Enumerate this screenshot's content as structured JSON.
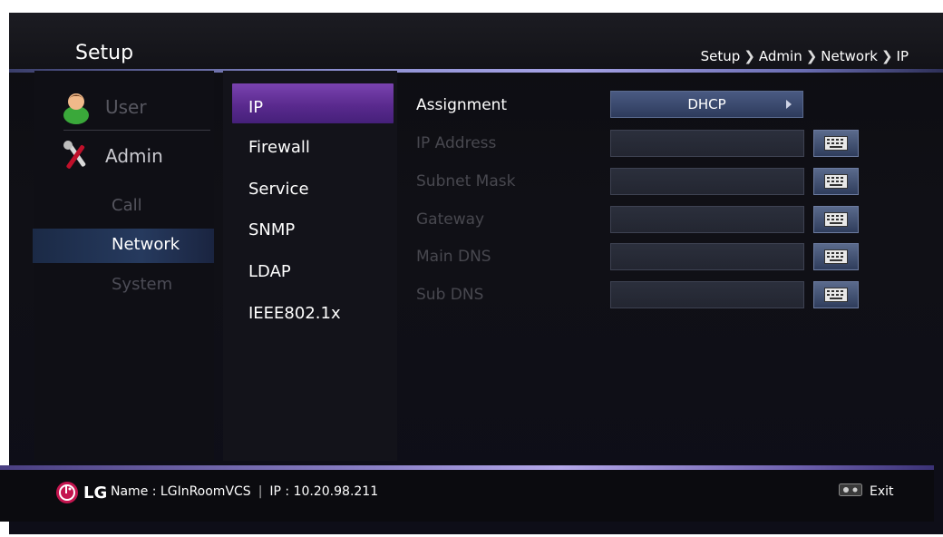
{
  "header": {
    "title": "Setup",
    "breadcrumb": [
      "Setup",
      "Admin",
      "Network",
      "IP"
    ],
    "breadcrumb_sep": "❯"
  },
  "left_menu": {
    "user_label": "User",
    "admin_label": "Admin",
    "sub_items": [
      "Call",
      "Network",
      "System"
    ],
    "selected": "Network"
  },
  "mid_menu": {
    "items": [
      "IP",
      "Firewall",
      "Service",
      "SNMP",
      "LDAP",
      "IEEE802.1x"
    ],
    "selected": "IP"
  },
  "form": {
    "assignment_label": "Assignment",
    "assignment_value": "DHCP",
    "fields": [
      {
        "label": "IP Address",
        "value": ""
      },
      {
        "label": "Subnet Mask",
        "value": ""
      },
      {
        "label": "Gateway",
        "value": ""
      },
      {
        "label": "Main DNS",
        "value": ""
      },
      {
        "label": "Sub DNS",
        "value": ""
      }
    ]
  },
  "footer": {
    "logo_text": "LG",
    "name_text": "Name : LGInRoomVCS",
    "sep": "|",
    "ip_text": "IP : 10.20.98.211",
    "exit_label": "Exit"
  },
  "colors": {
    "accent_purple": "#6a3aa2",
    "selection_blue": "#263a5e",
    "lg_red": "#c4154f"
  },
  "icons": [
    "user-icon",
    "tools-icon",
    "keyboard-icon",
    "lg-logo-icon",
    "exit-remote-icon",
    "chevron-right-icon"
  ]
}
